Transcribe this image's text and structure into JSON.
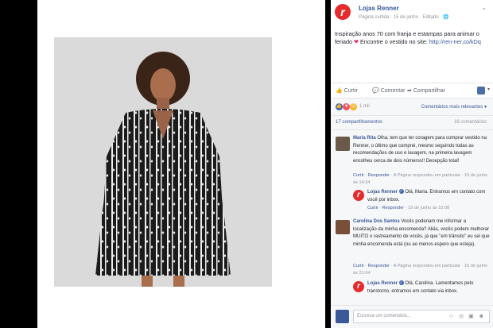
{
  "page": {
    "name": "Lojas Renner",
    "logo_letter": "r",
    "meta": "Página curtida · 15 de junho · Editado · 🌐",
    "chevron": "⌄"
  },
  "post": {
    "text_before_heart": "Inspiração anos 70 com franja e estampas para animar o feriado",
    "heart": "❤",
    "text_after_heart": "Encontre o vestido no site:",
    "link": "http://ren-ner.co/kDq"
  },
  "actions": {
    "like": "Curtir",
    "comment": "Comentar",
    "share": "Compartilhar"
  },
  "reactions": {
    "like_icon": "👍",
    "love_icon": "♥",
    "wow_icon": "😮",
    "count": "1 mil",
    "sort_label": "Comentários mais relevantes ▾"
  },
  "stats": {
    "shares": "17 compartilhamentos",
    "comments": "16 comentários"
  },
  "comments": [
    {
      "author": "Maria Rita",
      "text": "Olha, tem que ter coragem para comprar vestido na Renner, o último que comprei, mesmo seguindo todas as recomendações de uso e lavagem, na primeira lavagem encolheu cerca de dois números!! Decepção total!",
      "meta_like": "Curtir",
      "meta_reply": "Responder",
      "meta_rest": "· A Página respondeu em particular · 19 de junho às 14:34",
      "reply": {
        "author": "Lojas Renner",
        "text": "Olá, Maria. Entramos em contato com você por inbox.",
        "meta_like": "Curtir",
        "meta_reply": "Responder",
        "meta_rest": "· 19 de junho às 15:08"
      }
    },
    {
      "author": "Carolina Dos Santos",
      "text": "Vocês poderiam me informar a localização da minha encomenda? Aliás, vocês podem melhorar MUITO o rastreamento de vocês, já que \"em trânsito\" eu sei que minha encomenda está (ou ao menos espero que esteja).",
      "meta_like": "Curtir",
      "meta_reply": "Responder",
      "meta_rest": "· A Página respondeu em particular · 15 de junho às 21:04",
      "reply": {
        "author": "Lojas Renner",
        "text": "Olá, Carolina. Lamentamos pelo transtorno, entramos em contato via inbox.",
        "meta_like": "",
        "meta_reply": "",
        "meta_rest": ""
      }
    }
  ],
  "composer": {
    "placeholder": "Escreva um comentário...",
    "icons": "☺ ◎ ▣ ☻"
  },
  "colors": {
    "brand": "#e32c2c",
    "link": "#365899",
    "background": "#000000"
  }
}
